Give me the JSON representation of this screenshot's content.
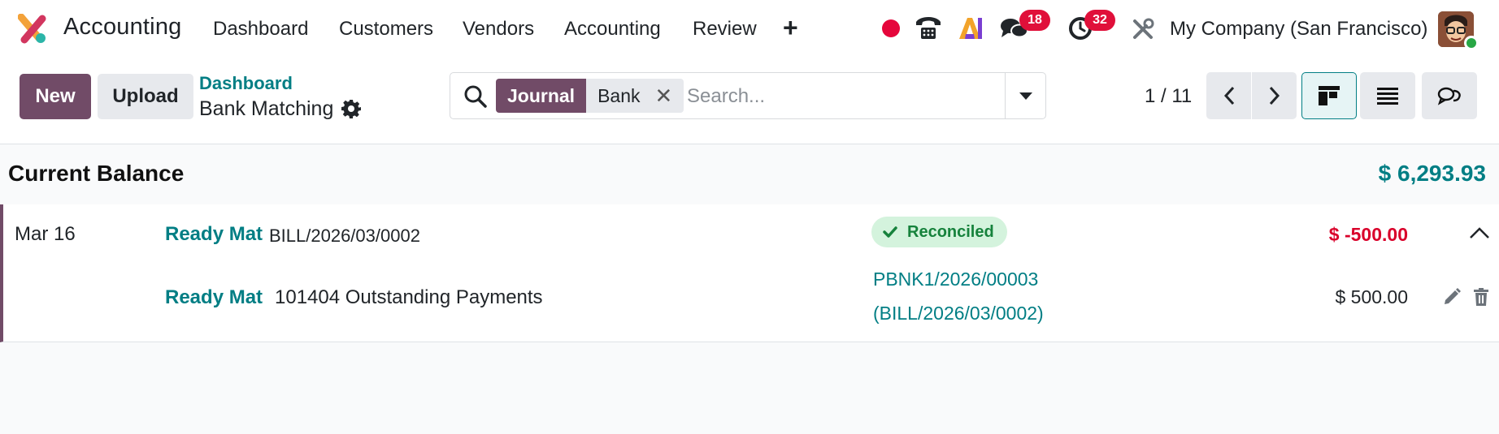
{
  "navbar": {
    "app_name": "Accounting",
    "menu": [
      "Dashboard",
      "Customers",
      "Vendors",
      "Accounting",
      "Review"
    ],
    "messages_count": "18",
    "activities_count": "32",
    "company": "My Company (San Francisco)",
    "icons": [
      "app-logo-icon",
      "plus-icon",
      "recording-dot-icon",
      "phone-icon",
      "ai-icon",
      "chat-icon",
      "clock-icon",
      "tools-icon",
      "user-avatar"
    ]
  },
  "control": {
    "new_label": "New",
    "upload_label": "Upload",
    "breadcrumb": "Dashboard",
    "title": "Bank Matching",
    "search": {
      "facet_label": "Journal",
      "facet_value": "Bank",
      "placeholder": "Search..."
    },
    "pager": "1 / 11"
  },
  "balance": {
    "label": "Current Balance",
    "value": "$ 6,293.93"
  },
  "statement": {
    "date": "Mar 16",
    "partner": "Ready Mat",
    "reference": "BILL/2026/03/0002",
    "status": "Reconciled",
    "amount": "$ -500.00",
    "line": {
      "partner": "Ready Mat",
      "account": "101404 Outstanding Payments",
      "ref_line1": "PBNK1/2026/00003",
      "ref_line2": "(BILL/2026/03/0002)",
      "amount": "$ 500.00"
    }
  },
  "colors": {
    "brand": "#714b67",
    "teal": "#017e84",
    "danger": "#d9002a",
    "success_bg": "#d4f3dd",
    "success_text": "#16823c"
  }
}
